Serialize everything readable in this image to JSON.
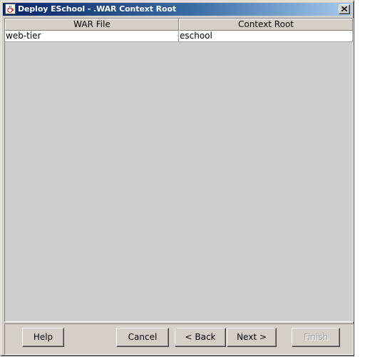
{
  "window": {
    "title": "Deploy ESchool - .WAR Context Root",
    "icons": {
      "app": "java-cup-icon",
      "close": "close-icon"
    }
  },
  "table": {
    "columns": [
      "WAR File",
      "Context Root"
    ],
    "rows": [
      {
        "war_file": "web-tier",
        "context_root": "eschool"
      }
    ]
  },
  "buttons": {
    "help": "Help",
    "cancel": "Cancel",
    "back": "< Back",
    "next": "Next >",
    "finish": "Finish",
    "finish_enabled": false
  },
  "colors": {
    "title_gradient_start": "#0a246a",
    "title_gradient_end": "#a6caf0",
    "face": "#d4d0c8",
    "table_background": "#cfcfcf"
  }
}
